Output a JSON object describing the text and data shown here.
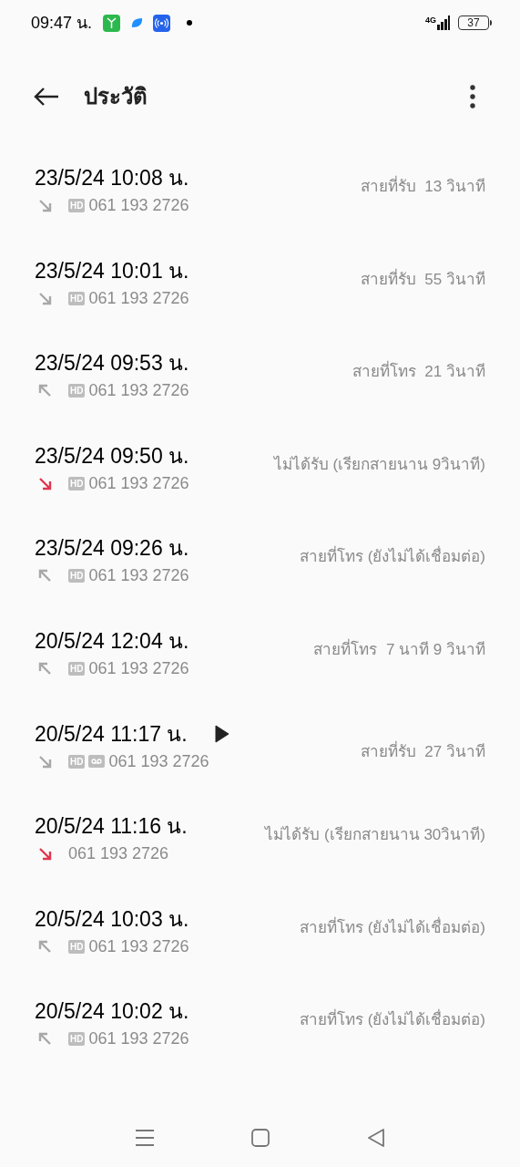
{
  "status_bar": {
    "time": "09:47 น.",
    "network": "4G",
    "battery": "37"
  },
  "header": {
    "title": "ประวัติ"
  },
  "calls": [
    {
      "date": "23/5/24 10:08 น.",
      "kind": "incoming",
      "badge": "HD",
      "voicemail": false,
      "play": false,
      "number": "061 193 2726",
      "status": "สายที่รับ  13 วินาที"
    },
    {
      "date": "23/5/24 10:01 น.",
      "kind": "incoming",
      "badge": "HD",
      "voicemail": false,
      "play": false,
      "number": "061 193 2726",
      "status": "สายที่รับ  55 วินาที"
    },
    {
      "date": "23/5/24 09:53 น.",
      "kind": "outgoing",
      "badge": "HD",
      "voicemail": false,
      "play": false,
      "number": "061 193 2726",
      "status": "สายที่โทร  21 วินาที"
    },
    {
      "date": "23/5/24 09:50 น.",
      "kind": "missed",
      "badge": "HD",
      "voicemail": false,
      "play": false,
      "number": "061 193 2726",
      "status": "ไม่ได้รับ (เรียกสายนาน 9วินาที)"
    },
    {
      "date": "23/5/24 09:26 น.",
      "kind": "outgoing",
      "badge": "HD",
      "voicemail": false,
      "play": false,
      "number": "061 193 2726",
      "status": "สายที่โทร (ยังไม่ได้เชื่อมต่อ)"
    },
    {
      "date": "20/5/24 12:04 น.",
      "kind": "outgoing",
      "badge": "HD",
      "voicemail": false,
      "play": false,
      "number": "061 193 2726",
      "status": "สายที่โทร  7 นาที 9 วินาที"
    },
    {
      "date": "20/5/24 11:17 น.",
      "kind": "incoming",
      "badge": "HD",
      "voicemail": true,
      "play": true,
      "number": "061 193 2726",
      "status": "สายที่รับ  27 วินาที"
    },
    {
      "date": "20/5/24 11:16 น.",
      "kind": "missed",
      "voicemail": false,
      "play": false,
      "number": "061 193 2726",
      "status": "ไม่ได้รับ (เรียกสายนาน 30วินาที)"
    },
    {
      "date": "20/5/24 10:03 น.",
      "kind": "outgoing",
      "badge": "HD",
      "voicemail": false,
      "play": false,
      "number": "061 193 2726",
      "status": "สายที่โทร (ยังไม่ได้เชื่อมต่อ)"
    },
    {
      "date": "20/5/24 10:02 น.",
      "kind": "outgoing",
      "badge": "HD",
      "voicemail": false,
      "play": false,
      "number": "061 193 2726",
      "status": "สายที่โทร (ยังไม่ได้เชื่อมต่อ)"
    }
  ]
}
